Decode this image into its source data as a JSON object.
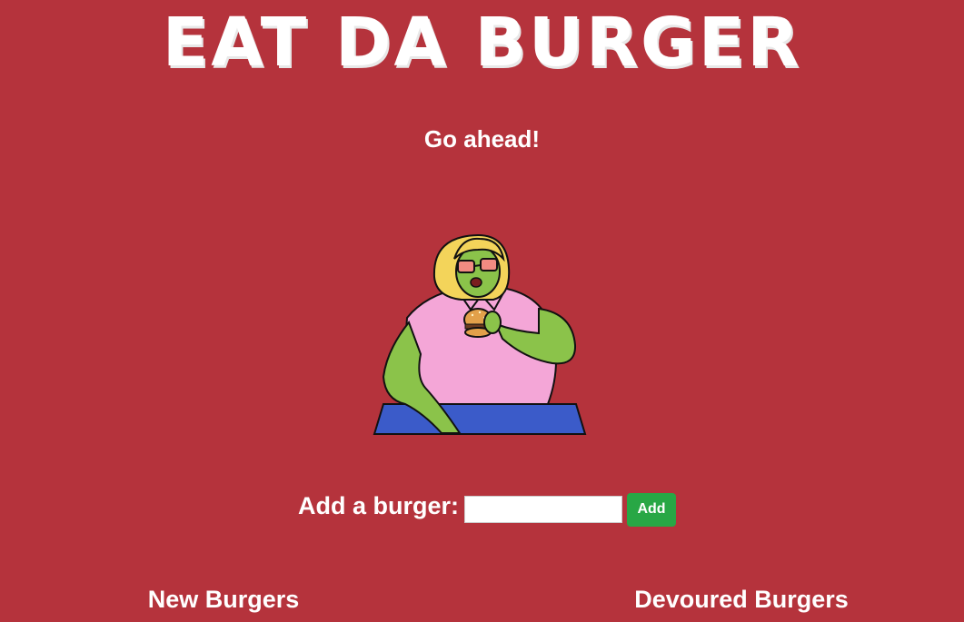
{
  "header": {
    "title": "EAT DA BURGER",
    "subtitle": "Go ahead!"
  },
  "illustration": {
    "icon": "burger-eating-character-illustration"
  },
  "form": {
    "label": "Add a burger:",
    "input_value": "",
    "input_placeholder": "",
    "button_label": "Add"
  },
  "lists": {
    "new_heading": "New Burgers",
    "devoured_heading": "Devoured Burgers"
  },
  "colors": {
    "background": "#b5333c",
    "button": "#28a745",
    "text": "#ffffff"
  }
}
